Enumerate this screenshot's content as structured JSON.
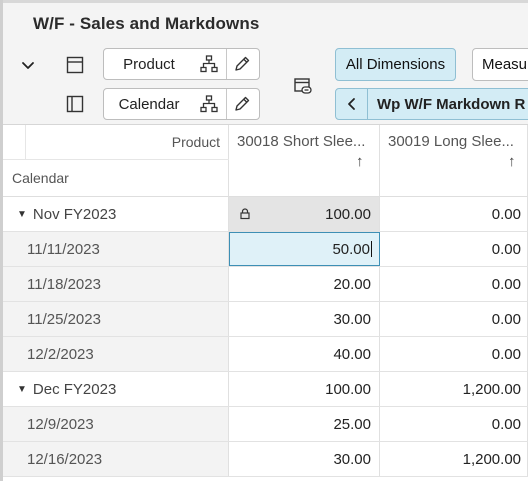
{
  "window": {
    "title": "W/F - Sales and Markdowns"
  },
  "toolbar": {
    "row_dim": {
      "label": "Product"
    },
    "col_dim": {
      "label": "Calendar"
    },
    "all_dimensions_label": "All Dimensions",
    "measures_label": "Measu",
    "worksheet_label": "Wp W/F Markdown R"
  },
  "grid": {
    "header": {
      "product_label": "Product",
      "calendar_label": "Calendar",
      "columns": [
        {
          "label": "30018 Short Slee...",
          "sort": "↑"
        },
        {
          "label": "30019 Long Slee...",
          "sort": "↑"
        }
      ]
    },
    "rows": [
      {
        "label": "Nov FY2023",
        "values": [
          "100.00",
          "0.00"
        ]
      },
      {
        "label": "11/11/2023",
        "values": [
          "50.00",
          "0.00"
        ]
      },
      {
        "label": "11/18/2023",
        "values": [
          "20.00",
          "0.00"
        ]
      },
      {
        "label": "11/25/2023",
        "values": [
          "30.00",
          "0.00"
        ]
      },
      {
        "label": "12/2/2023",
        "values": [
          "40.00",
          "0.00"
        ]
      },
      {
        "label": "Dec FY2023",
        "values": [
          "100.00",
          "1,200.00"
        ]
      },
      {
        "label": "12/9/2023",
        "values": [
          "25.00",
          "0.00"
        ]
      },
      {
        "label": "12/16/2023",
        "values": [
          "30.00",
          "1,200.00"
        ]
      }
    ]
  },
  "icons": {
    "collapse": "chevron-down-icon",
    "row_layout": "panel-top-icon",
    "col_layout": "panel-left-icon",
    "hierarchy": "hierarchy-icon",
    "edit": "pencil-icon",
    "linked_view": "linked-view-icon",
    "back": "chevron-left-icon",
    "lock": "lock-icon"
  }
}
